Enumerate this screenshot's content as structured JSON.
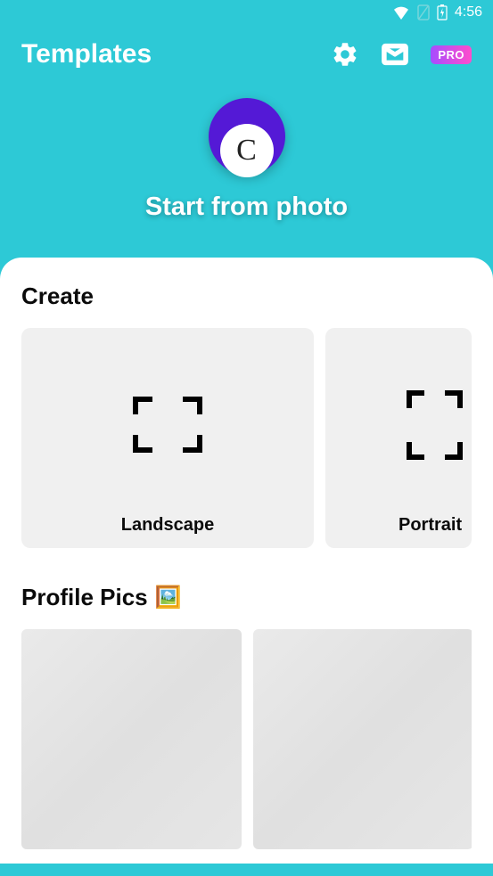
{
  "status_bar": {
    "time": "4:56"
  },
  "header": {
    "title": "Templates",
    "pro_badge": "PRO"
  },
  "hero": {
    "logo_letter": "C",
    "cta": "Start from photo"
  },
  "sections": {
    "create": {
      "title": "Create",
      "items": [
        {
          "label": "Landscape"
        },
        {
          "label": "Portrait"
        }
      ]
    },
    "profile_pics": {
      "title": "Profile Pics",
      "emoji": "🖼️"
    }
  }
}
